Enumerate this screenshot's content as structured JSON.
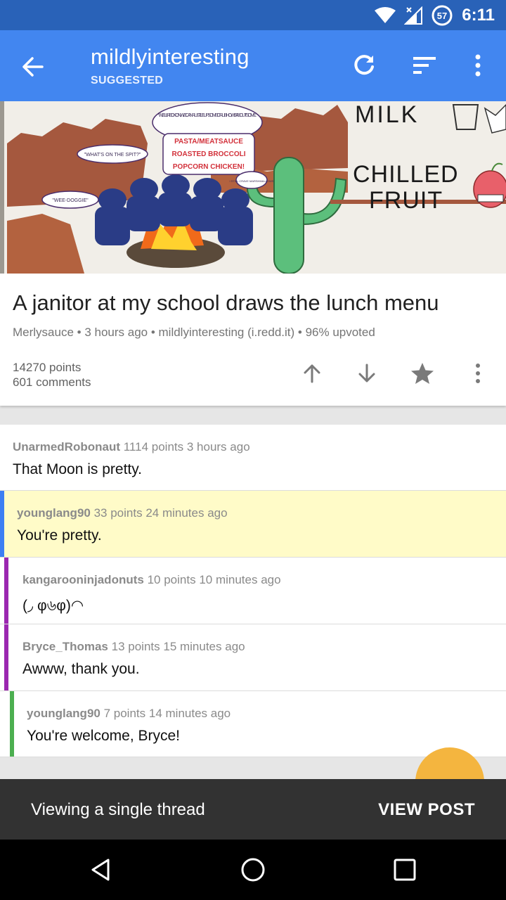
{
  "status_bar": {
    "time": "6:11",
    "battery_level": "57",
    "icons": [
      "wifi-icon",
      "no-signal-icon",
      "battery-icon"
    ]
  },
  "app_bar": {
    "title": "mildlyinteresting",
    "subtitle": "SUGGESTED",
    "icons": [
      "back-arrow-icon",
      "refresh-icon",
      "sort-icon",
      "overflow-menu-icon"
    ]
  },
  "hero_image": {
    "bubbles": [
      "\"WELL I RECKON WE CAN RUSTLE UP SOME GRUB! HOW'S ABOUT SOME...",
      "PASTA/MEATSAUCE",
      "ROASTED BROCCOLI",
      "POPCORN CHICKEN!",
      "\"WHAT'S ON THE SPIT?\"",
      "\"WEE-DOGGIE\"",
      "I STILL CRAVE MARSHMALLOWS"
    ],
    "right_text": [
      "MILK",
      "CHILLED",
      "FRUIT"
    ]
  },
  "post": {
    "title": "A janitor at my school draws the lunch menu",
    "meta": "Merlysauce • 3 hours ago • mildlyinteresting (i.redd.it) • 96% upvoted",
    "points": "14270 points",
    "comments": "601 comments",
    "actions": [
      "upvote-icon",
      "downvote-icon",
      "save-star-icon",
      "overflow-menu-icon"
    ]
  },
  "comments": [
    {
      "author": "UnarmedRobonaut",
      "points": "1114 points",
      "age": "3 hours ago",
      "body": "That Moon is pretty.",
      "depth": 0,
      "bar_color": "",
      "highlight": false
    },
    {
      "author": "younglang90",
      "points": "33 points",
      "age": "24 minutes ago",
      "body": "You're pretty.",
      "depth": 1,
      "bar_color": "#3d7ef3",
      "highlight": true
    },
    {
      "author": "kangarooninjadonuts",
      "points": "10 points",
      "age": "10 minutes ago",
      "body": "(◞ φ৬φ)◠",
      "depth": 2,
      "bar_color": "#9b27b0",
      "highlight": false
    },
    {
      "author": "Bryce_Thomas",
      "points": "13 points",
      "age": "15 minutes ago",
      "body": "Awww, thank you.",
      "depth": 2,
      "bar_color": "#9b27b0",
      "highlight": false
    },
    {
      "author": "younglang90",
      "points": "7 points",
      "age": "14 minutes ago",
      "body": "You're welcome, Bryce!",
      "depth": 3,
      "bar_color": "#4caf50",
      "highlight": false
    }
  ],
  "snackbar": {
    "message": "Viewing a single thread",
    "action": "VIEW POST"
  },
  "colors": {
    "status_bar": "#2962b8",
    "app_bar": "#4286f0",
    "highlight": "#fffbc8",
    "fab": "#f4b53f"
  }
}
